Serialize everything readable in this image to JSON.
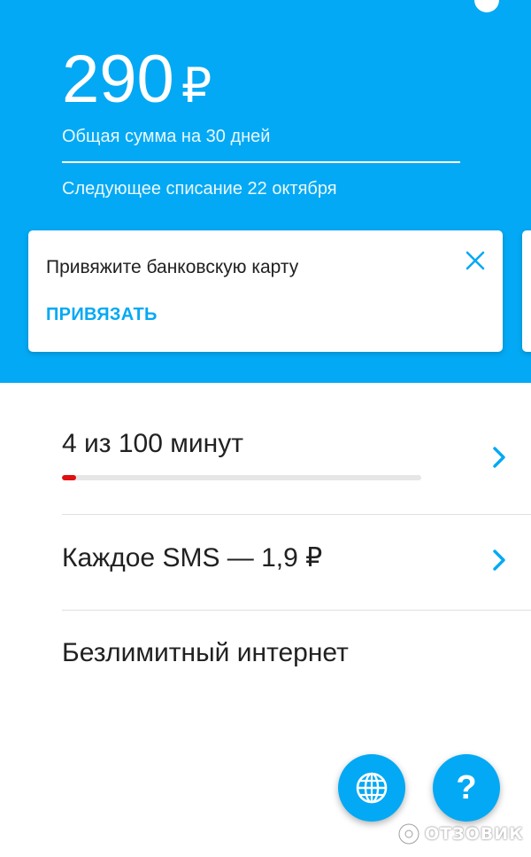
{
  "balance": {
    "amount": "290",
    "currency": "₽",
    "period_label": "Общая сумма на 30 дней",
    "next_charge_label": "Следующее списание 22 октября"
  },
  "card_prompt": {
    "text": "Привяжите банковскую карту",
    "action_label": "ПРИВЯЗАТЬ",
    "close_icon": "close-icon"
  },
  "plan_items": [
    {
      "label": "4 из 100 минут",
      "progress": {
        "used": 4,
        "total": 100
      },
      "icon": "chevron-right-icon"
    },
    {
      "label": "Каждое SMS — 1,9 ₽",
      "icon": "chevron-right-icon"
    },
    {
      "label": "Безлимитный интернет"
    }
  ],
  "fabs": [
    {
      "icon": "globe-icon"
    },
    {
      "icon": "help-icon",
      "glyph": "?"
    }
  ],
  "watermark": {
    "text": "ОТЗОВИК"
  },
  "colors": {
    "accent": "#03a9f4",
    "progress_used": "#e01010",
    "progress_track": "#e6e6e6",
    "text_primary": "#212121"
  }
}
